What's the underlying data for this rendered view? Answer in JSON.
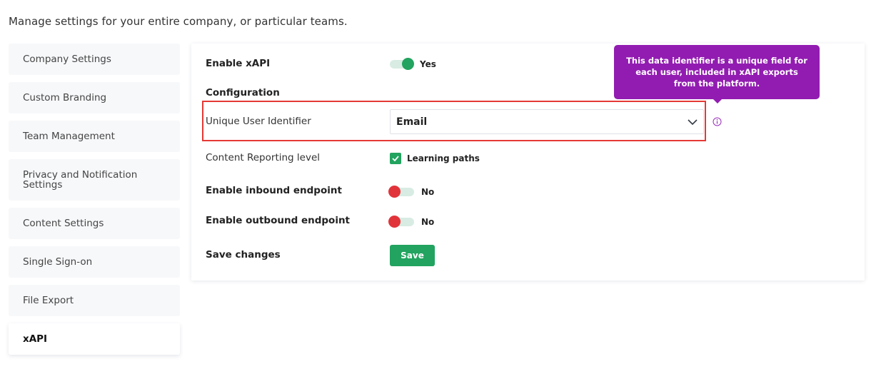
{
  "page": {
    "description": "Manage settings for your entire company, or particular teams."
  },
  "sidebar": {
    "items": [
      {
        "label": "Company Settings",
        "active": false
      },
      {
        "label": "Custom Branding",
        "active": false
      },
      {
        "label": "Team Management",
        "active": false
      },
      {
        "label": "Privacy and Notification Settings",
        "active": false
      },
      {
        "label": "Content Settings",
        "active": false
      },
      {
        "label": "Single Sign-on",
        "active": false
      },
      {
        "label": "File Export",
        "active": false
      },
      {
        "label": "xAPI",
        "active": true
      }
    ]
  },
  "xapi": {
    "enable_xapi": {
      "label": "Enable xAPI",
      "value": true,
      "state_text": "Yes"
    },
    "configuration_heading": "Configuration",
    "unique_user_identifier": {
      "label": "Unique User Identifier",
      "selected": "Email",
      "tooltip": "This data identifier is a unique field for each user, included in xAPI exports from the platform."
    },
    "content_reporting": {
      "label": "Content Reporting level",
      "option": "Learning paths",
      "checked": true
    },
    "inbound_endpoint": {
      "label": "Enable inbound endpoint",
      "value": false,
      "state_text": "No"
    },
    "outbound_endpoint": {
      "label": "Enable outbound endpoint",
      "value": false,
      "state_text": "No"
    },
    "save": {
      "label": "Save changes",
      "button": "Save"
    }
  },
  "colors": {
    "accent_green": "#22a35f",
    "off_red": "#e1343a",
    "tooltip_purple": "#921cb1",
    "highlight_red": "#e53935"
  }
}
